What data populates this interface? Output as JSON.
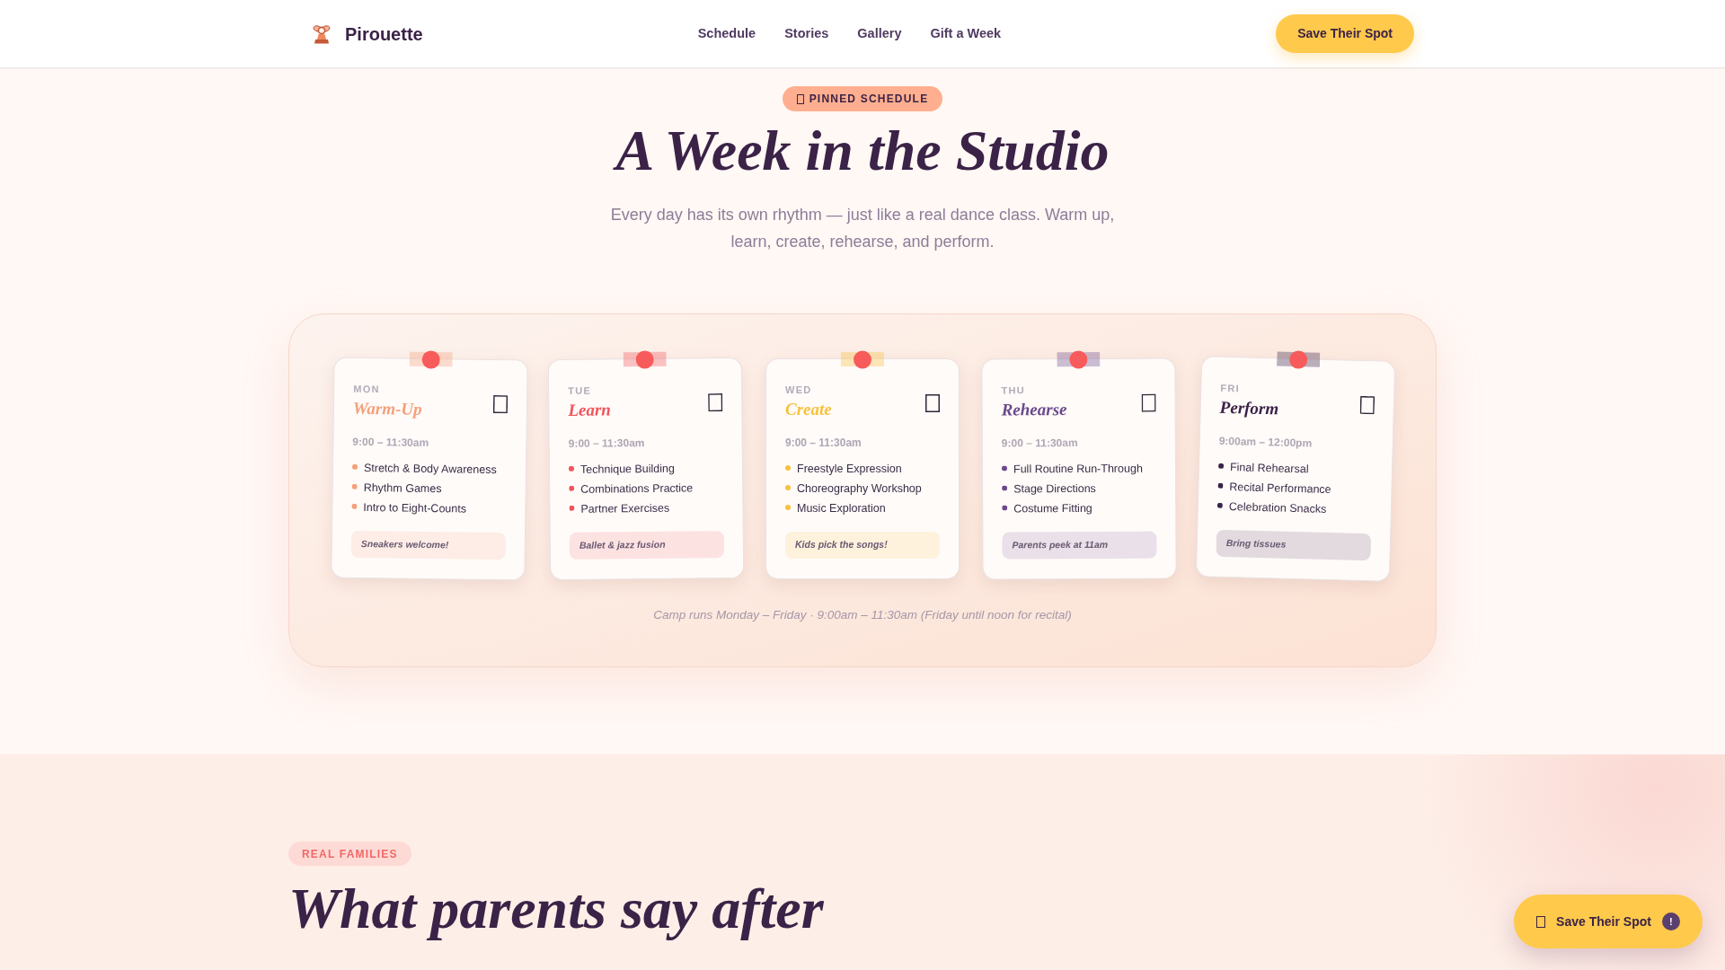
{
  "header": {
    "brand": "Pirouette",
    "nav": [
      {
        "label": "Schedule"
      },
      {
        "label": "Stories"
      },
      {
        "label": "Gallery"
      },
      {
        "label": "Gift a Week"
      }
    ],
    "cta": "Save Their Spot"
  },
  "hero": {
    "badge": "PINNED SCHEDULE",
    "title": "A Week in the Studio",
    "subtitle": "Every day has its own rhythm — just like a real dance class. Warm up, learn, create, rehearse, and perform."
  },
  "schedule": {
    "days": [
      {
        "day": "MON",
        "title": "Warm-Up",
        "color": "#f4a07a",
        "time": "9:00 – 11:30am",
        "activities": [
          "Stretch & Body Awareness",
          "Rhythm Games",
          "Intro to Eight-Counts"
        ],
        "note": "Sneakers welcome!"
      },
      {
        "day": "TUE",
        "title": "Learn",
        "color": "#f0555c",
        "time": "9:00 – 11:30am",
        "activities": [
          "Technique Building",
          "Combinations Practice",
          "Partner Exercises"
        ],
        "note": "Ballet & jazz fusion"
      },
      {
        "day": "WED",
        "title": "Create",
        "color": "#f7c13d",
        "time": "9:00 – 11:30am",
        "activities": [
          "Freestyle Expression",
          "Choreography Workshop",
          "Music Exploration"
        ],
        "note": "Kids pick the songs!"
      },
      {
        "day": "THU",
        "title": "Rehearse",
        "color": "#6a4a8c",
        "time": "9:00 – 11:30am",
        "activities": [
          "Full Routine Run-Through",
          "Stage Directions",
          "Costume Fitting"
        ],
        "note": "Parents peek at 11am"
      },
      {
        "day": "FRI",
        "title": "Perform",
        "color": "#3b2248",
        "time": "9:00am – 12:00pm",
        "activities": [
          "Final Rehearsal",
          "Recital Performance",
          "Celebration Snacks"
        ],
        "note": "Bring tissues"
      }
    ],
    "footnote": "Camp runs Monday – Friday · 9:00am – 11:30am (Friday until noon for recital)"
  },
  "testimonials": {
    "badge": "REAL FAMILIES",
    "title": "What parents say after"
  },
  "floating_button": {
    "label": "Save Their Spot",
    "badge": "!"
  }
}
